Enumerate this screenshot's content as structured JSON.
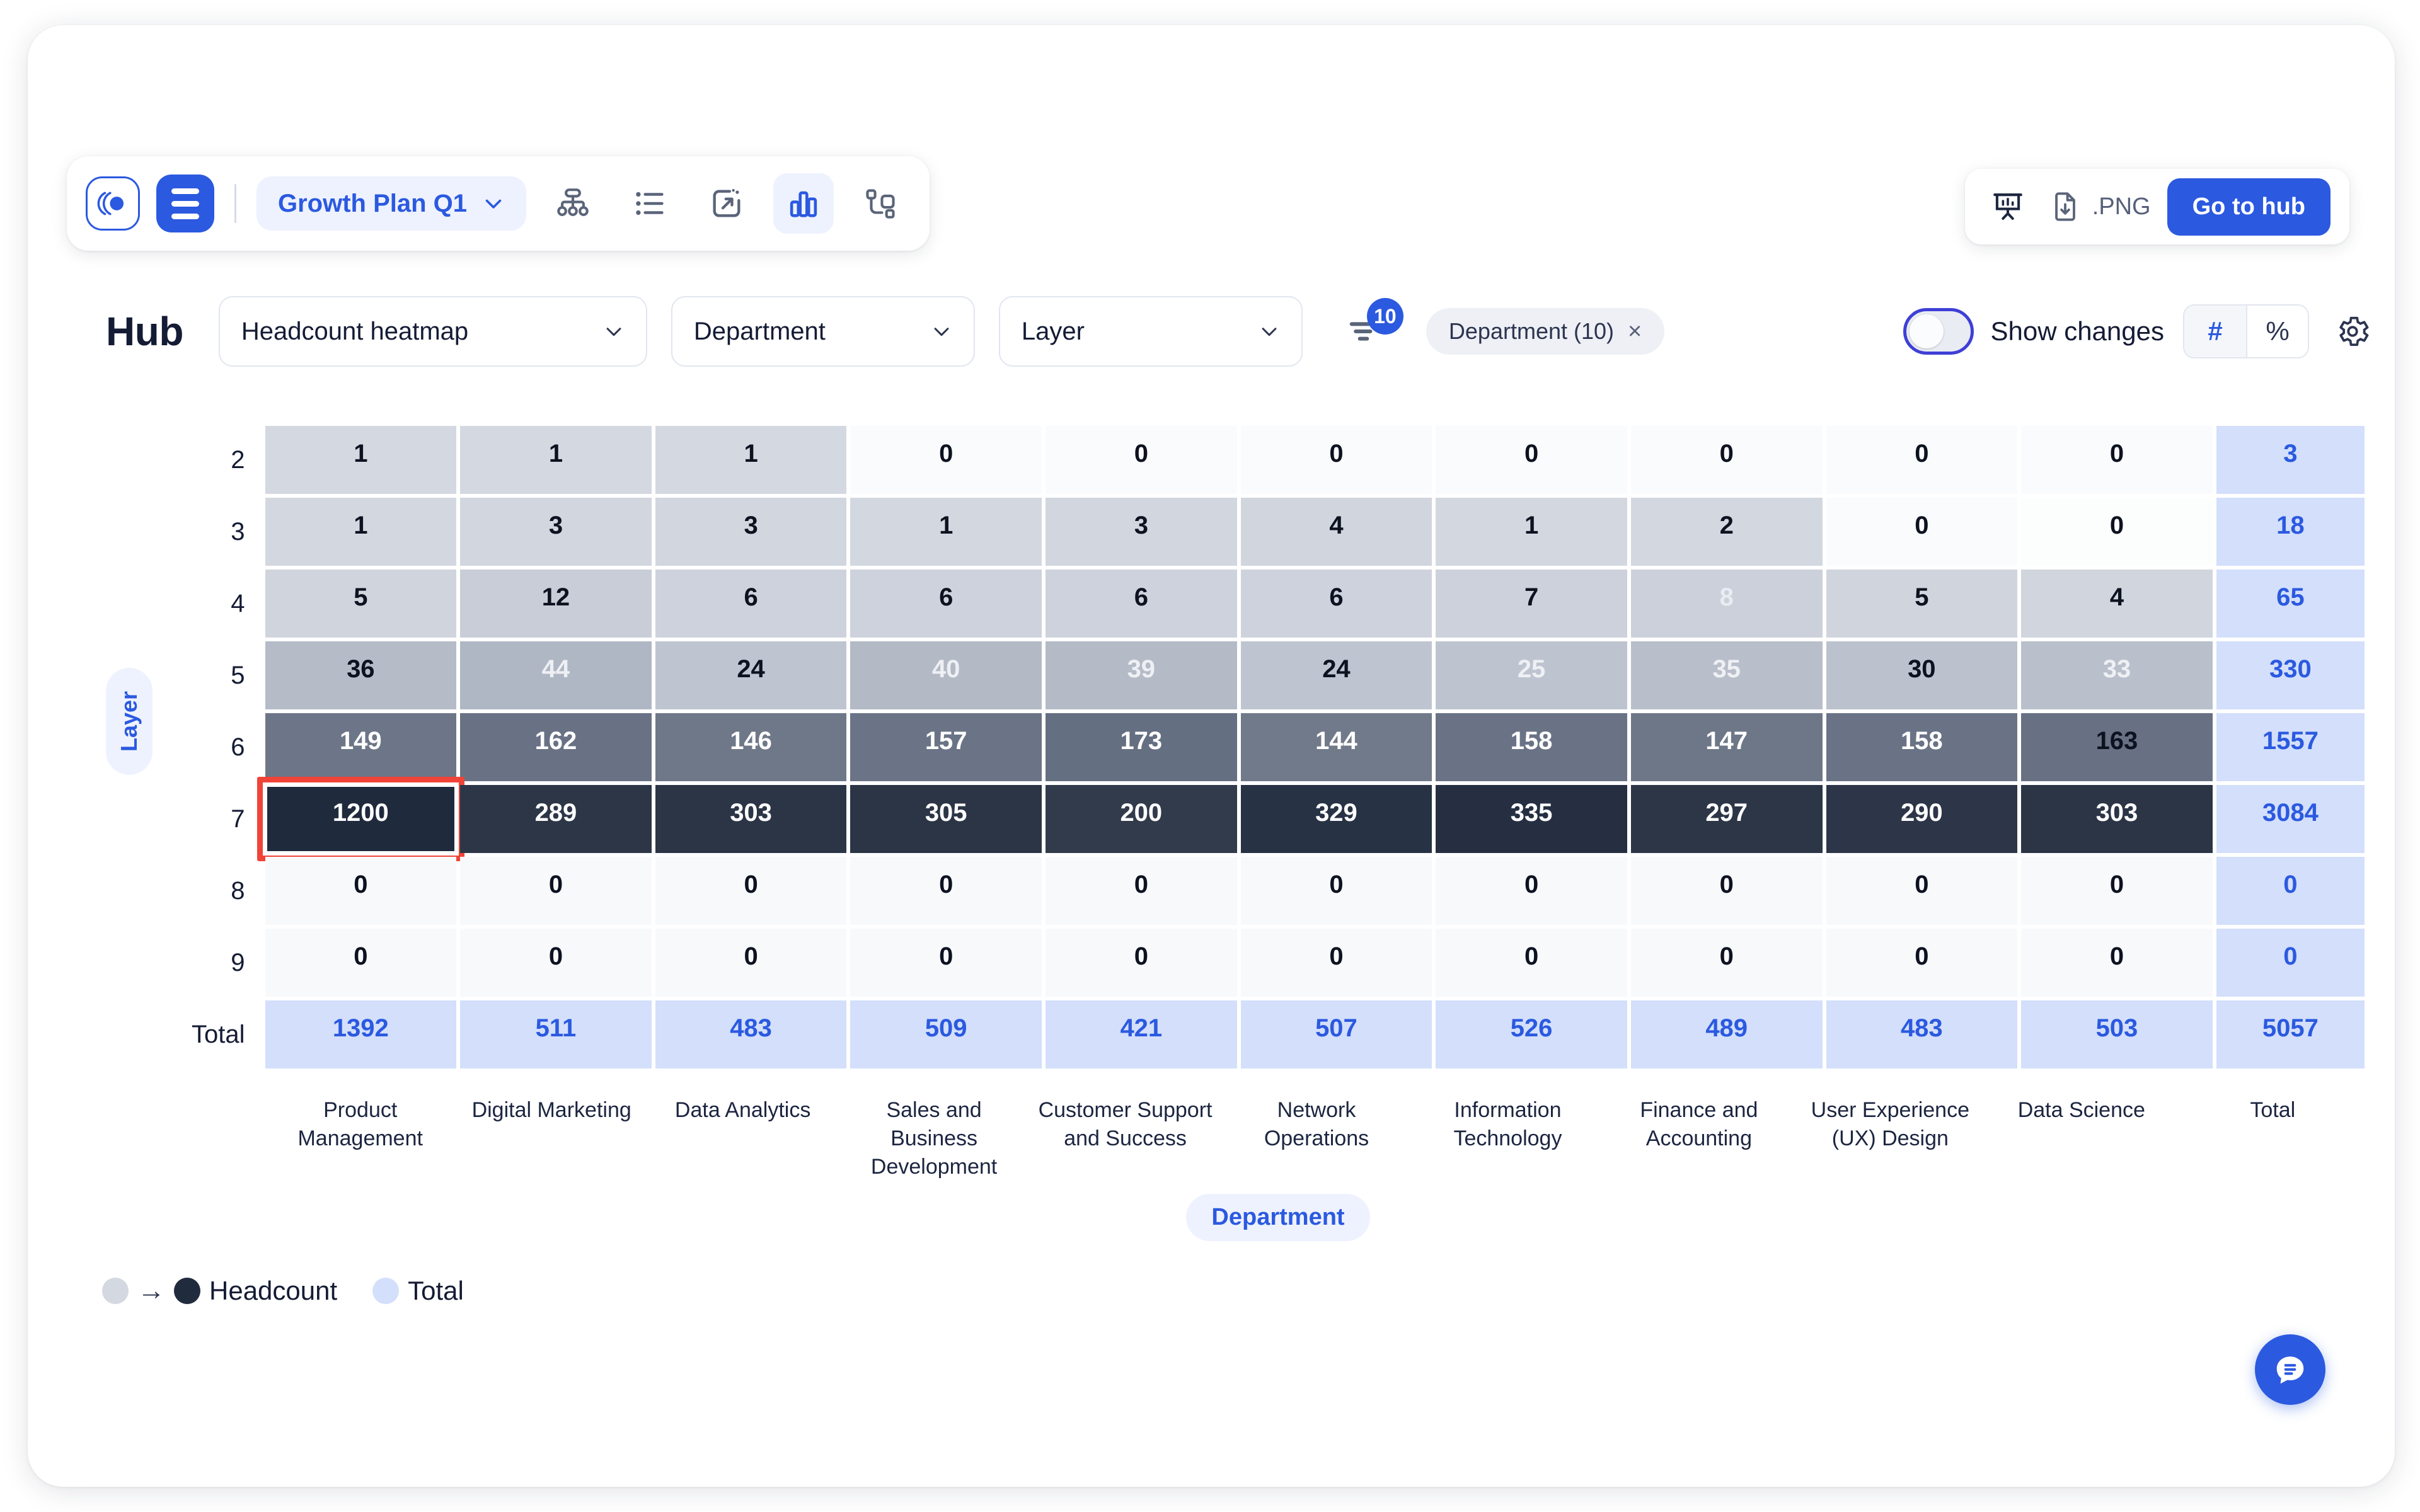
{
  "toolbar": {
    "logo_icon": "app-logo-icon",
    "menu_icon": "hamburger-menu-icon",
    "plan_label": "Growth Plan Q1",
    "plan_chevron": "chevron-down-icon",
    "views": [
      {
        "name": "org-chart-icon",
        "active": false
      },
      {
        "name": "list-view-icon",
        "active": false
      },
      {
        "name": "scenario-icon",
        "active": false
      },
      {
        "name": "bar-chart-icon",
        "active": true
      },
      {
        "name": "node-map-icon",
        "active": false
      }
    ]
  },
  "toolbar_right": {
    "present_icon": "presentation-icon",
    "download_icon": "file-download-icon",
    "export_label": ".PNG",
    "hub_button_label": "Go to hub"
  },
  "filterbar": {
    "title": "Hub",
    "metric_select": {
      "value": "Headcount heatmap"
    },
    "group_select": {
      "value": "Department"
    },
    "layer_select": {
      "value": "Layer"
    },
    "filter_icon": "filter-icon",
    "filter_count": "10",
    "chip_label": "Department (10)",
    "chip_close": "×",
    "toggle_label": "Show changes",
    "toggle_on": false,
    "unit_number": "#",
    "unit_percent": "%",
    "unit_selected": "#",
    "settings_icon": "gear-icon"
  },
  "heatmap": {
    "axis_y_label": "Layer",
    "axis_x_label": "Department",
    "row_total_label": "Total",
    "col_total_label": "Total",
    "selected_cell": {
      "row": 5,
      "col": 0
    },
    "legend": {
      "low_color": "#d4d8e1",
      "high_color": "#212b3e",
      "arrow": "→",
      "series_label": "Headcount",
      "total_color": "#d3dffb",
      "total_label": "Total"
    }
  },
  "chart_data": {
    "type": "heatmap",
    "title": "Headcount heatmap",
    "xlabel": "Department",
    "ylabel": "Layer",
    "legend": [
      "Headcount",
      "Total"
    ],
    "row_labels": [
      "2",
      "3",
      "4",
      "5",
      "6",
      "7",
      "8",
      "9"
    ],
    "columns": [
      "Product Management",
      "Digital Marketing",
      "Data Analytics",
      "Sales and Business Development",
      "Customer Support and Success",
      "Network Operations",
      "Information Technology",
      "Finance and Accounting",
      "User Experience (UX) Design",
      "Data Science"
    ],
    "values": [
      [
        1,
        1,
        1,
        0,
        0,
        0,
        0,
        0,
        0,
        0
      ],
      [
        1,
        3,
        3,
        1,
        3,
        4,
        1,
        2,
        0,
        0
      ],
      [
        5,
        12,
        6,
        6,
        6,
        6,
        7,
        8,
        5,
        4
      ],
      [
        36,
        44,
        24,
        40,
        39,
        24,
        25,
        35,
        30,
        33
      ],
      [
        149,
        162,
        146,
        157,
        173,
        144,
        158,
        147,
        158,
        163
      ],
      [
        1200,
        289,
        303,
        305,
        200,
        329,
        335,
        297,
        290,
        303
      ],
      [
        0,
        0,
        0,
        0,
        0,
        0,
        0,
        0,
        0,
        0
      ],
      [
        0,
        0,
        0,
        0,
        0,
        0,
        0,
        0,
        0,
        0
      ]
    ],
    "row_totals": [
      3,
      18,
      65,
      330,
      1557,
      3084,
      0,
      0
    ],
    "col_totals": [
      1392,
      511,
      483,
      509,
      421,
      507,
      526,
      489,
      483,
      503
    ],
    "grand_total": 5057,
    "cell_bg": [
      [
        "#d4d8e1",
        "#d4d8e1",
        "#d4d8e1",
        "#fafbfc",
        "#fafbfc",
        "#fafbfc",
        "#fafbfc",
        "#fafbfc",
        "#fafbfc",
        "#fafbfc"
      ],
      [
        "#d3d8e0",
        "#d1d6df",
        "#d1d6df",
        "#d3d8e0",
        "#d1d6df",
        "#d0d5de",
        "#d3d8e0",
        "#d2d7e0",
        "#fafbfc",
        "#fcfdfd"
      ],
      [
        "#cfd4dd",
        "#c8cdd7",
        "#cdd2dc",
        "#cdd2dc",
        "#cdd2dc",
        "#cdd2dc",
        "#ccd1db",
        "#cbd0da",
        "#cfd4dd",
        "#d0d5de"
      ],
      [
        "#b5bcc8",
        "#b0b7c4",
        "#bfc5d0",
        "#b3bac6",
        "#b4bbc7",
        "#bfc5d0",
        "#bec4cf",
        "#b8bfca",
        "#bbc2cd",
        "#b9c0cb"
      ],
      [
        "#6d7688",
        "#697285",
        "#6f7889",
        "#6b7486",
        "#656f82",
        "#717a8a",
        "#6a7386",
        "#6e7788",
        "#6a7386",
        "#687184"
      ],
      [
        "#202a3d",
        "#2c3647",
        "#2b3546",
        "#2b3546",
        "#323b4c",
        "#283245",
        "#262f42",
        "#2c3647",
        "#2d3648",
        "#2b3546"
      ],
      [
        "#f8f9fb",
        "#f8f9fb",
        "#f8f9fb",
        "#f8f9fb",
        "#f8f9fb",
        "#f8f9fb",
        "#f8f9fb",
        "#f8f9fb",
        "#f8f9fb",
        "#f8f9fb"
      ],
      [
        "#f8f9fb",
        "#f8f9fb",
        "#f8f9fb",
        "#f8f9fb",
        "#f8f9fb",
        "#f8f9fb",
        "#f8f9fb",
        "#f8f9fb",
        "#f8f9fb",
        "#f8f9fb"
      ]
    ],
    "cell_fg": [
      [
        "#0d1220",
        "#0d1220",
        "#0d1220",
        "#0d1220",
        "#0d1220",
        "#0d1220",
        "#0d1220",
        "#0d1220",
        "#0d1220",
        "#0d1220"
      ],
      [
        "#0d1220",
        "#0d1220",
        "#0d1220",
        "#0d1220",
        "#0d1220",
        "#0d1220",
        "#0d1220",
        "#0d1220",
        "#0d1220",
        "#0d1220"
      ],
      [
        "#0d1220",
        "#0d1220",
        "#0d1220",
        "#0d1220",
        "#0d1220",
        "#0d1220",
        "#0d1220",
        "#e9ecf2",
        "#0d1220",
        "#0d1220"
      ],
      [
        "#0d1220",
        "#eef0f4",
        "#0d1220",
        "#eef0f4",
        "#eef0f4",
        "#0d1220",
        "#eef0f4",
        "#eef0f4",
        "#0d1220",
        "#eef0f4"
      ],
      [
        "#ffffff",
        "#ffffff",
        "#ffffff",
        "#ffffff",
        "#ffffff",
        "#ffffff",
        "#ffffff",
        "#ffffff",
        "#ffffff",
        "#0d1220"
      ],
      [
        "#ffffff",
        "#ffffff",
        "#ffffff",
        "#ffffff",
        "#ffffff",
        "#ffffff",
        "#ffffff",
        "#ffffff",
        "#ffffff",
        "#ffffff"
      ],
      [
        "#0d1220",
        "#0d1220",
        "#0d1220",
        "#0d1220",
        "#0d1220",
        "#0d1220",
        "#0d1220",
        "#0d1220",
        "#0d1220",
        "#0d1220"
      ],
      [
        "#0d1220",
        "#0d1220",
        "#0d1220",
        "#0d1220",
        "#0d1220",
        "#0d1220",
        "#0d1220",
        "#0d1220",
        "#0d1220",
        "#0d1220"
      ]
    ],
    "total_bg": "#d3dffb",
    "total_fg": "#2b59e0"
  },
  "fab": {
    "icon": "chat-bubble-icon"
  }
}
